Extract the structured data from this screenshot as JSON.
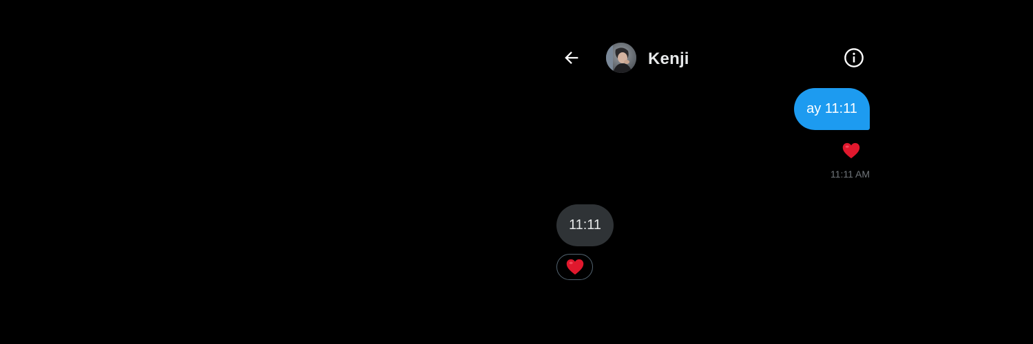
{
  "header": {
    "back_icon": "arrow-left-icon",
    "avatar_icon": "profile-photo",
    "contact_name": "Kenji",
    "info_icon": "info-circle-icon"
  },
  "messages": [
    {
      "direction": "outgoing",
      "text": "ay 11:11",
      "reaction": "heart-icon",
      "timestamp": "11:11 AM"
    },
    {
      "direction": "incoming",
      "text": "11:11",
      "reaction": "heart-icon"
    }
  ],
  "colors": {
    "background": "#000000",
    "outgoing_bubble": "#1d9bf0",
    "incoming_bubble": "#2f3336",
    "heart": "#e0182d",
    "timestamp": "#71767b",
    "text_primary": "#e7e9ea"
  }
}
